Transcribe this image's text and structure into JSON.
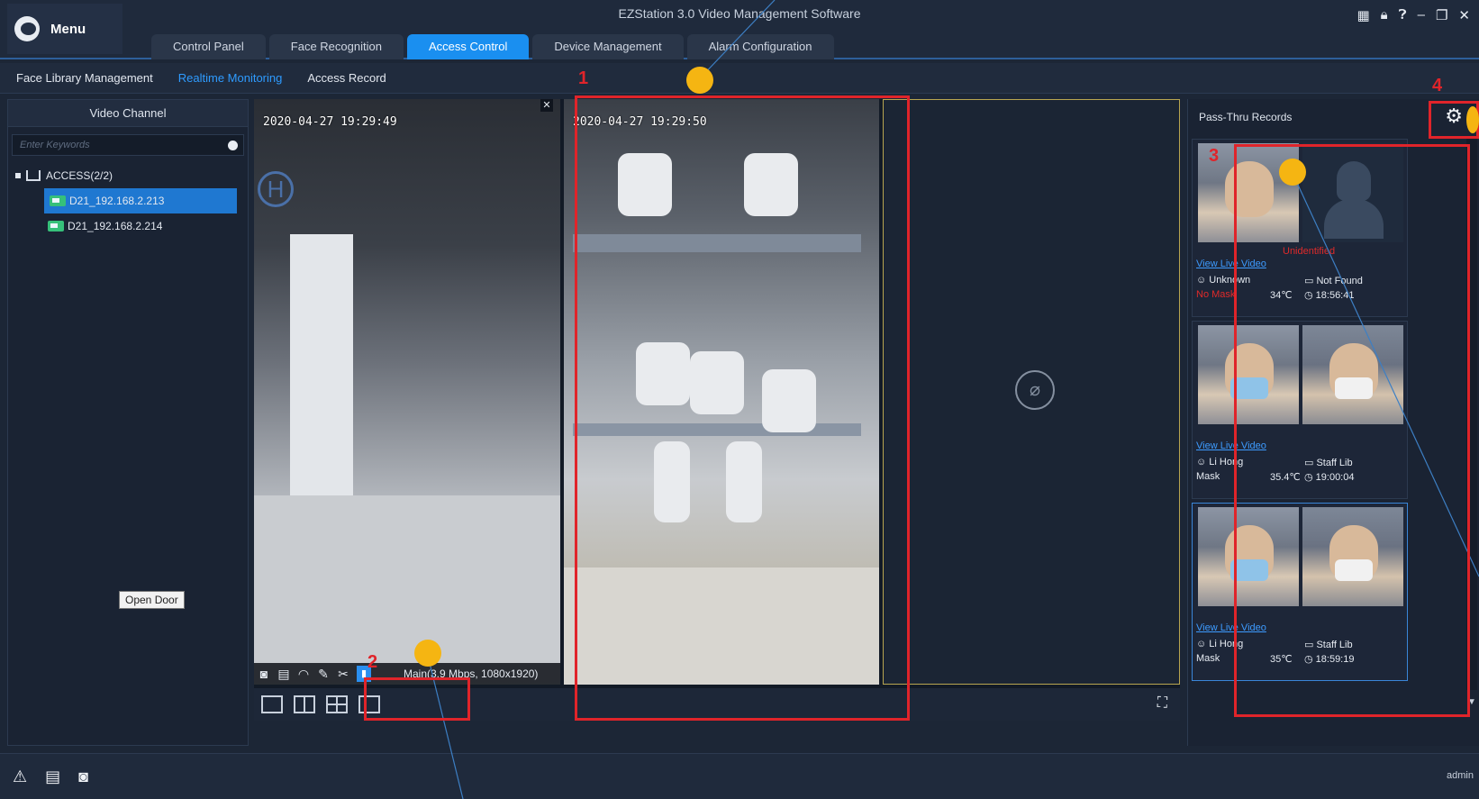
{
  "app": {
    "menu_label": "Menu",
    "title": "EZStation 3.0 Video Management Software",
    "tabs": [
      {
        "label": "Control Panel"
      },
      {
        "label": "Face Recognition"
      },
      {
        "label": "Access Control"
      },
      {
        "label": "Device Management"
      },
      {
        "label": "Alarm Configuration"
      }
    ],
    "active_tab": "Access Control",
    "window_icons": [
      "grid-icon",
      "lock-icon",
      "help-icon",
      "minimize-icon",
      "restore-icon",
      "close-icon"
    ]
  },
  "subnav": {
    "items": [
      {
        "label": "Face Library Management"
      },
      {
        "label": "Realtime Monitoring"
      },
      {
        "label": "Access Record"
      }
    ],
    "active": "Realtime Monitoring"
  },
  "left_panel": {
    "header": "Video Channel",
    "search_placeholder": "Enter Keywords",
    "tree": {
      "root": "ACCESS(2/2)",
      "devices": [
        {
          "label": "D21_192.168.2.213",
          "selected": true
        },
        {
          "label": "D21_192.168.2.214",
          "selected": false
        }
      ]
    }
  },
  "video": {
    "cells": [
      {
        "timestamp": "2020-04-27 19:29:49"
      },
      {
        "timestamp": "2020-04-27 19:29:50"
      }
    ],
    "stream_info": "Main(3.9 Mbps, 1080x1920)",
    "tooltip": "Open Door",
    "close_glyph": "✕"
  },
  "right_panel": {
    "header": "Pass-Thru Records",
    "records": [
      {
        "status": "Unidentified",
        "link": "View Live Video",
        "name": "Unknown",
        "library": "Not Found",
        "mask": "No Mask",
        "temperature": "34℃",
        "time": "18:56:41",
        "mask_alert": true
      },
      {
        "status": "",
        "link": "View Live Video",
        "name": "Li Hong",
        "library": "Staff Lib",
        "mask": "Mask",
        "temperature": "35.4℃",
        "time": "19:00:04",
        "mask_alert": false
      },
      {
        "status": "",
        "link": "View Live Video",
        "name": "Li Hong",
        "library": "Staff Lib",
        "mask": "Mask",
        "temperature": "35℃",
        "time": "18:59:19",
        "mask_alert": false
      }
    ]
  },
  "statusbar": {
    "user": "admin"
  },
  "annotations": {
    "labels": [
      "1",
      "2",
      "3",
      "4"
    ]
  },
  "colors": {
    "accent": "#1a8ff0",
    "annotation_red": "#e0242a",
    "annotation_dot": "#f5b512",
    "alert_red": "#e02a2a"
  }
}
